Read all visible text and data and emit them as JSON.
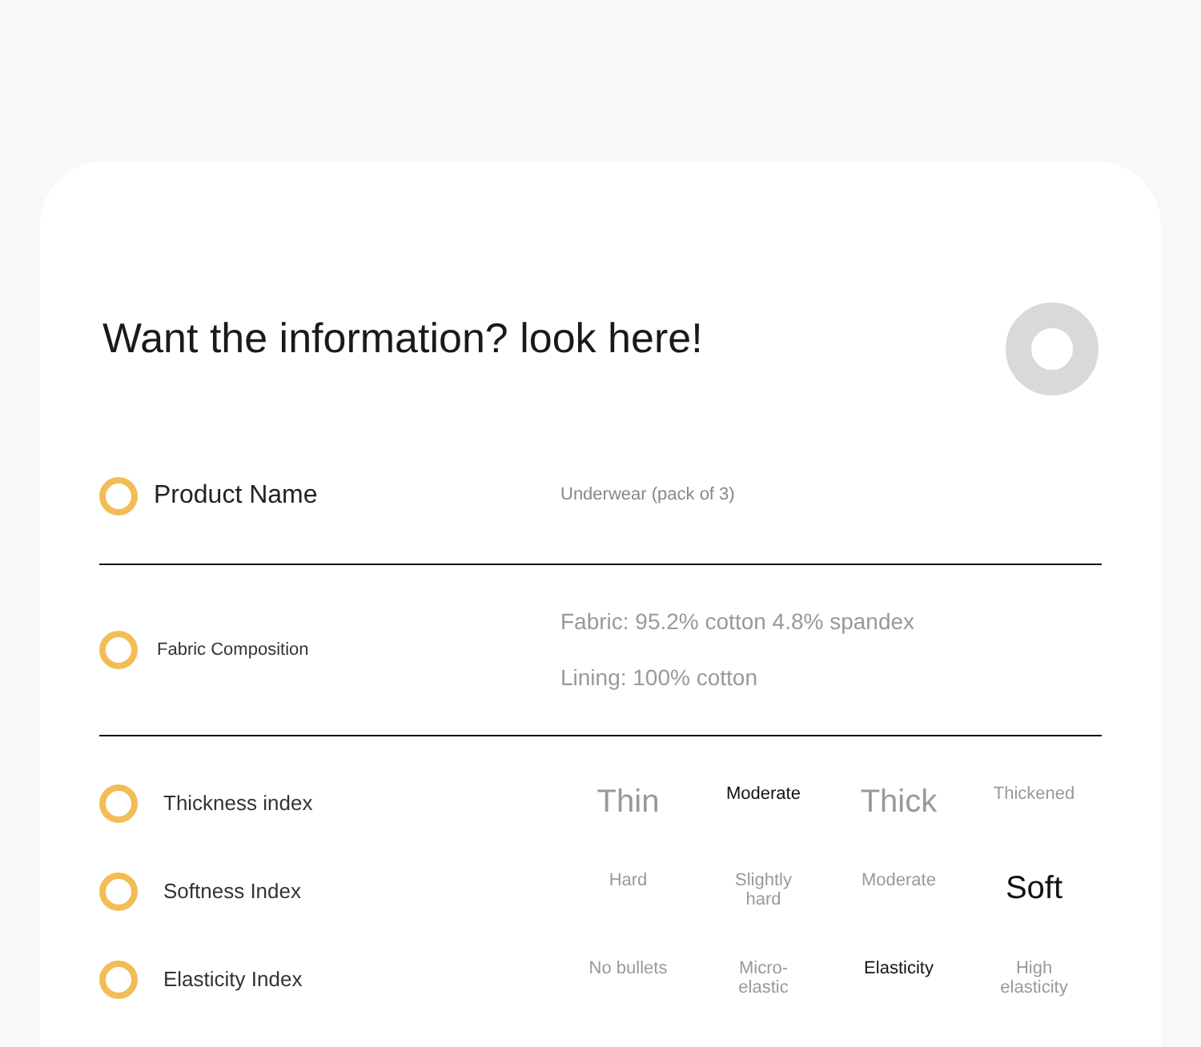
{
  "title": "Want the information? look here!",
  "info_rows": [
    {
      "label": "Product Name",
      "kind": "large",
      "values": [
        "Underwear (pack of 3)"
      ]
    },
    {
      "label": "Fabric Composition",
      "kind": "small",
      "values": [
        "Fabric: 95.2% cotton 4.8% spandex",
        "Lining: 100% cotton"
      ]
    }
  ],
  "indexes": [
    {
      "label": "Thickness index",
      "options": [
        {
          "text": "Thin",
          "selected": false,
          "kind": "large"
        },
        {
          "text": "Moderate",
          "selected": true,
          "kind": "small"
        },
        {
          "text": "Thick",
          "selected": false,
          "kind": "large"
        },
        {
          "text": "Thickened",
          "selected": false,
          "kind": "small"
        }
      ]
    },
    {
      "label": "Softness Index",
      "options": [
        {
          "text": "Hard",
          "selected": false,
          "kind": "small"
        },
        {
          "text": "Slightly hard",
          "selected": false,
          "kind": "small"
        },
        {
          "text": "Moderate",
          "selected": false,
          "kind": "small"
        },
        {
          "text": "Soft",
          "selected": true,
          "kind": "large"
        }
      ]
    },
    {
      "label": "Elasticity Index",
      "options": [
        {
          "text": "No bullets",
          "selected": false,
          "kind": "small"
        },
        {
          "text": "Micro-elastic",
          "selected": false,
          "kind": "small"
        },
        {
          "text": "Elasticity",
          "selected": true,
          "kind": "small"
        },
        {
          "text": "High elasticity",
          "selected": false,
          "kind": "small"
        }
      ]
    }
  ]
}
